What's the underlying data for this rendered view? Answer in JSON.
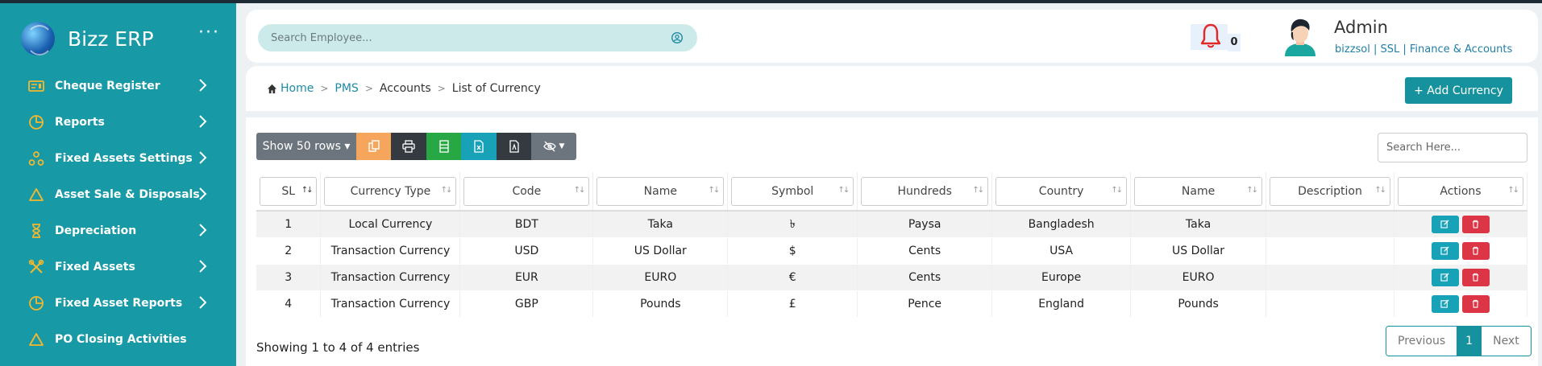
{
  "app": {
    "name": "Bizz ERP"
  },
  "sidebar": {
    "items": [
      {
        "label": "Cheque Register",
        "icon": "cheque-icon",
        "has_children": true
      },
      {
        "label": "Reports",
        "icon": "pie-chart-icon",
        "has_children": true
      },
      {
        "label": "Fixed Assets Settings",
        "icon": "nodes-icon",
        "has_children": true
      },
      {
        "label": "Asset Sale & Disposals",
        "icon": "triangle-icon",
        "has_children": true
      },
      {
        "label": "Depreciation",
        "icon": "hourglass-icon",
        "has_children": true
      },
      {
        "label": "Fixed Assets",
        "icon": "tools-icon",
        "has_children": true
      },
      {
        "label": "Fixed Asset Reports",
        "icon": "pie-chart-icon",
        "has_children": true
      },
      {
        "label": "PO Closing Activities",
        "icon": "triangle-icon",
        "has_children": false
      }
    ]
  },
  "header": {
    "search_placeholder": "Search Employee...",
    "notification_count": "0",
    "user_name": "Admin",
    "user_info": "bizzsol | SSL  | Finance & Accounts"
  },
  "breadcrumb": {
    "home": "Home",
    "pms": "PMS",
    "accounts": "Accounts",
    "current": "List of Currency"
  },
  "add_button_label": "+ Add Currency",
  "toolbar": {
    "show_rows_label": "Show 50 rows ▾"
  },
  "table_search_placeholder": "Search Here...",
  "table": {
    "columns": [
      "SL",
      "Currency Type",
      "Code",
      "Name",
      "Symbol",
      "Hundreds",
      "Country",
      "Name",
      "Description",
      "Actions"
    ],
    "rows": [
      [
        "1",
        "Local Currency",
        "BDT",
        "Taka",
        "৳",
        "Paysa",
        "Bangladesh",
        "Taka",
        ""
      ],
      [
        "2",
        "Transaction Currency",
        "USD",
        "US Dollar",
        "$",
        "Cents",
        "USA",
        "US Dollar",
        ""
      ],
      [
        "3",
        "Transaction Currency",
        "EUR",
        "EURO",
        "€",
        "Cents",
        "Europe",
        "EURO",
        ""
      ],
      [
        "4",
        "Transaction Currency",
        "GBP",
        "Pounds",
        "£",
        "Pence",
        "England",
        "Pounds",
        ""
      ]
    ]
  },
  "table_info": "Showing 1 to 4 of 4 entries",
  "pagination": {
    "previous": "Previous",
    "current": "1",
    "next": "Next"
  },
  "colors": {
    "sidebar": "#1799a6",
    "accent": "#16919e",
    "icon_accent": "#f5b82e",
    "edit": "#17a2b8",
    "delete": "#dc3545"
  }
}
